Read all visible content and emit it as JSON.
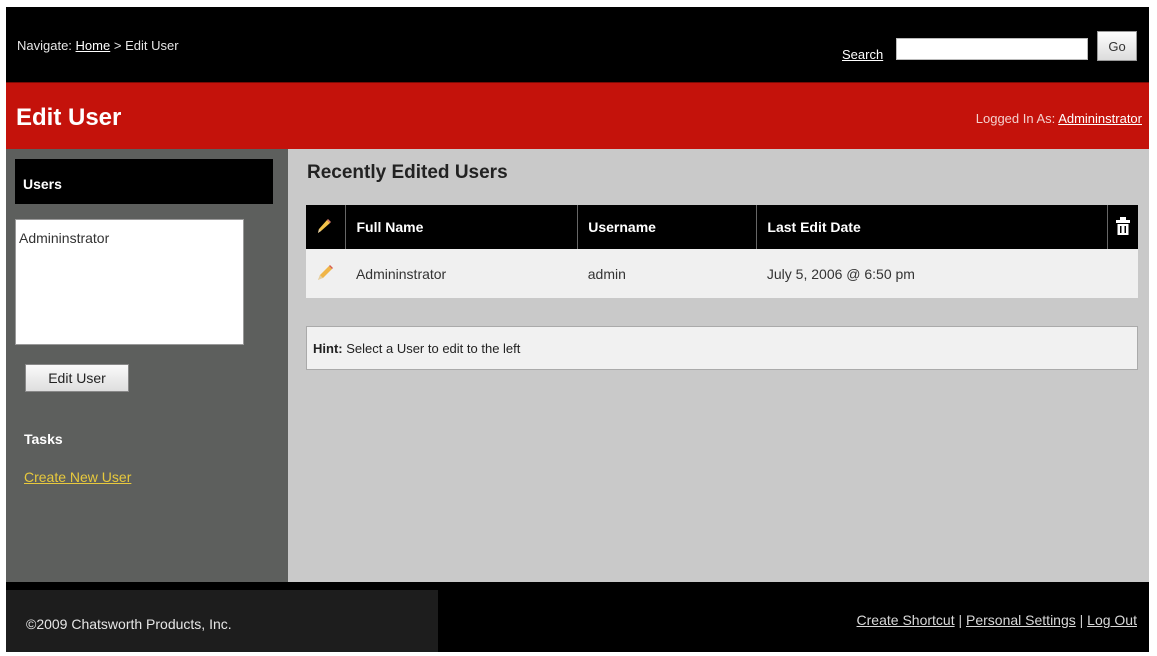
{
  "nav": {
    "prefix": "Navigate:",
    "home_link": "Home",
    "separator": ">",
    "current": "Edit User",
    "search_link": "Search",
    "search_value": "",
    "go_label": "Go"
  },
  "header": {
    "title": "Edit User",
    "logged_in_prefix": "Logged In As:",
    "logged_in_user": "Admininstrator"
  },
  "sidebar": {
    "users_title": "Users",
    "user_list": [
      "Admininstrator"
    ],
    "edit_button": "Edit User",
    "tasks_title": "Tasks",
    "create_link": "Create New User"
  },
  "main": {
    "title": "Recently Edited Users",
    "columns": {
      "edit_icon": "pencil-icon",
      "full_name": "Full Name",
      "username": "Username",
      "last_edit": "Last Edit Date",
      "delete_icon": "trash-icon"
    },
    "rows": [
      {
        "full_name": "Admininstrator",
        "username": "admin",
        "last_edit": "July 5, 2006 @ 6:50 pm"
      }
    ],
    "hint_label": "Hint:",
    "hint_text": "Select a User to edit to the left"
  },
  "footer": {
    "copyright": "©2009 Chatsworth Products, Inc.",
    "links": [
      "Create Shortcut",
      "Personal Settings",
      "Log Out"
    ],
    "separator": "|"
  },
  "colors": {
    "header_red": "#c4120b",
    "sidebar_gray": "#5d5f5d",
    "main_gray": "#c9c9c9",
    "link_yellow": "#e8c93d"
  }
}
